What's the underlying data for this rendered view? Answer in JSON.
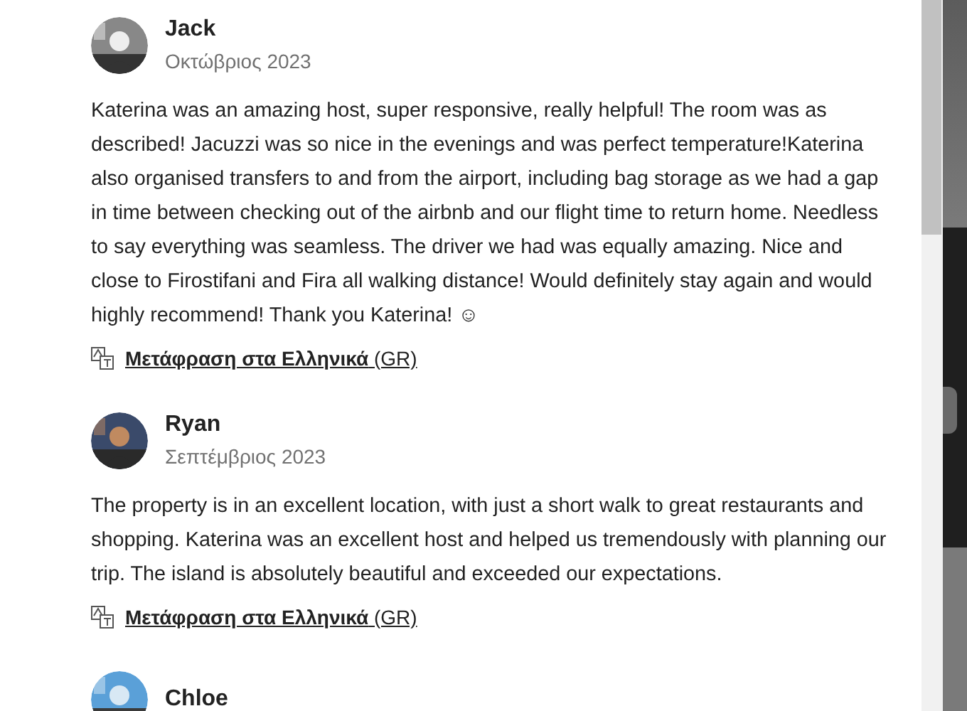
{
  "reviews": [
    {
      "name": "Jack",
      "date": "Οκτώβριος 2023",
      "text": "Katerina was an amazing host, super responsive, really helpful! The room was as described! Jacuzzi was so nice in the evenings and was perfect temperature!Katerina also organised transfers to and from the airport, including bag storage as we had a gap in time between checking out of the airbnb and our flight time to return home. Needless to say everything was seamless. The driver we had was equally amazing. Nice and close to Firostifani and Fira all walking distance! Would definitely stay again and would highly recommend! Thank you Katerina! ☺",
      "translate": "**Μετάφραση στα Ελληνικά** (GR)"
    },
    {
      "name": "Ryan",
      "date": "Σεπτέμβριος 2023",
      "text": "The property is in an excellent location, with just a short walk to great restaurants and shopping. Katerina was an excellent host and helped us tremendously with planning our trip. The island is absolutely beautiful and exceeded our expectations.",
      "translate": "**Μετάφραση στα Ελληνικά** (GR)"
    },
    {
      "name": "Chloe"
    }
  ]
}
